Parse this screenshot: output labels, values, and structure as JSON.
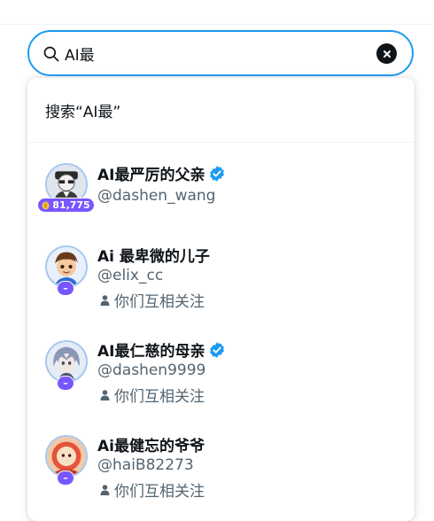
{
  "search": {
    "query": "AI最",
    "search_for_label": "搜索“AI最”"
  },
  "colors": {
    "accent": "#1d9bf0",
    "badge": "#7856ff",
    "secondary_text": "#536471"
  },
  "users": [
    {
      "name": "AI最严厉的父亲",
      "handle": "@dashen_wang",
      "verified": true,
      "badge": "81,775",
      "badge_icon": "coin-icon",
      "follow_text": ""
    },
    {
      "name": "Ai 最卑微的儿子",
      "handle": "@elix_cc",
      "verified": false,
      "badge": "–",
      "follow_text": "你们互相关注"
    },
    {
      "name": "AI最仁慈的母亲",
      "handle": "@dashen9999",
      "verified": true,
      "badge": "–",
      "follow_text": "你们互相关注"
    },
    {
      "name": "Ai最健忘的爷爷",
      "handle": "@haiB82273",
      "verified": false,
      "badge": "–",
      "follow_text": "你们互相关注"
    }
  ]
}
